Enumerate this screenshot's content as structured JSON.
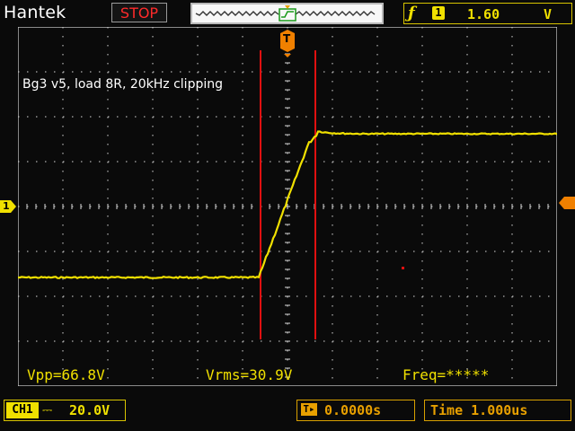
{
  "header": {
    "brand": "Hantek",
    "run_state": "STOP",
    "trigger": {
      "edge_symbol": "ƒ",
      "channel": "1",
      "level": "1.60",
      "unit": "V"
    }
  },
  "screen": {
    "annotation": "Bg3 v5, load 8R, 20kHz clipping",
    "trigger_marker": "T",
    "channel_marker": "1",
    "measurements": {
      "vpp": "Vpp=66.8V",
      "vrms": "Vrms=30.9V",
      "freq": "Freq=*****"
    }
  },
  "footer": {
    "channel_tag": "CH1",
    "coupling_symbol": "⎓",
    "volts_per_div": "20.0V",
    "horizontal_position": "0.0000s",
    "timebase": "Time 1.000us"
  },
  "colors": {
    "trace": "#f0e000",
    "cursor": "#e01010",
    "grid": "#d8d8d8",
    "trigger_marker": "#f08000"
  }
}
